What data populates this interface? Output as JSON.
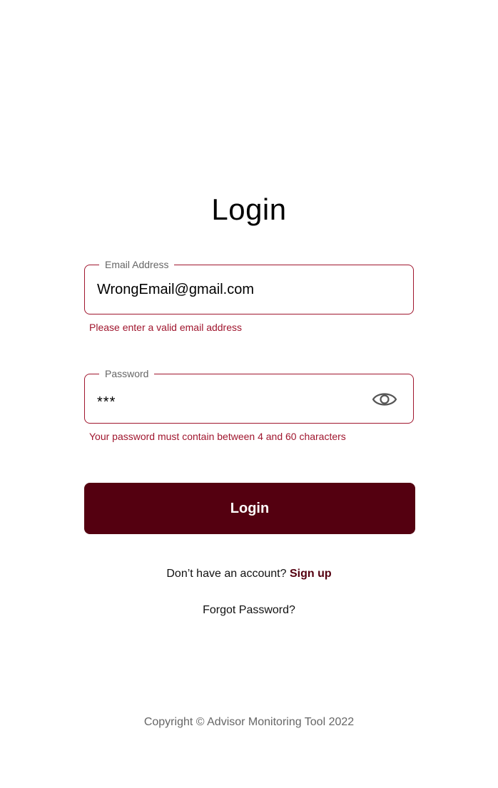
{
  "page": {
    "title": "Login"
  },
  "email": {
    "label": "Email Address",
    "value": "WrongEmail@gmail.com",
    "error": "Please enter a valid email address"
  },
  "password": {
    "label": "Password",
    "value": "***",
    "error": "Your password must contain between 4 and 60 characters",
    "toggle_icon": "eye-icon"
  },
  "login_button": {
    "label": "Login"
  },
  "signup": {
    "prompt": "Don’t have an account?",
    "link_label": "Sign up"
  },
  "forgot_password": {
    "label": "Forgot Password?"
  },
  "footer": {
    "copyright_word": "Copyright",
    "copyright_symbol": "©",
    "owner": "Advisor Monitoring Tool 2022"
  },
  "colors": {
    "accent": "#540010",
    "error": "#a0162e",
    "muted_text": "#666666"
  }
}
